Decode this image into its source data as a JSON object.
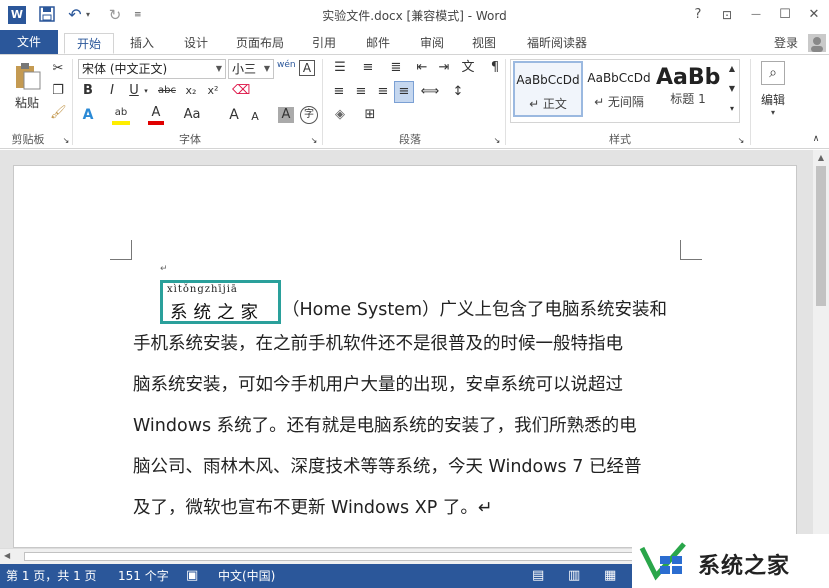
{
  "window": {
    "title": "实验文件.docx [兼容模式] - Word",
    "help": "?",
    "ribbon_display": "⊡",
    "minimize": "—",
    "maximize": "☐",
    "close": "✕"
  },
  "quick_access": {
    "word_icon": "W",
    "save": "💾",
    "undo": "↶",
    "redo": "↻",
    "customize": "≡"
  },
  "tabs": [
    {
      "label": "文件"
    },
    {
      "label": "开始"
    },
    {
      "label": "插入"
    },
    {
      "label": "设计"
    },
    {
      "label": "页面布局"
    },
    {
      "label": "引用"
    },
    {
      "label": "邮件"
    },
    {
      "label": "审阅"
    },
    {
      "label": "视图"
    },
    {
      "label": "福昕阅读器"
    }
  ],
  "signin": "登录",
  "ribbon": {
    "clipboard": {
      "paste": "粘贴",
      "label": "剪贴板"
    },
    "font": {
      "name": "宋体 (中文正文)",
      "size": "小三",
      "wen": "wén",
      "A_box": "A",
      "bold": "B",
      "italic": "I",
      "underline": "U",
      "strike": "abc",
      "sub": "x₂",
      "sup": "x²",
      "grow": "A",
      "shrink": "A",
      "case": "Aa",
      "label": "字体"
    },
    "paragraph": {
      "label": "段落"
    },
    "styles": {
      "items": [
        {
          "sample": "AaBbCcDd",
          "name": "↵ 正文"
        },
        {
          "sample": "AaBbCcDd",
          "name": "↵ 无间隔"
        },
        {
          "sample": "AaBb",
          "name": "标题 1"
        }
      ],
      "label": "样式"
    },
    "editing": {
      "label": "编辑"
    }
  },
  "document": {
    "ruby_pinyin": "xìtǒngzhījiā",
    "ruby_chars": "系统之家",
    "lines": [
      "（Home System）广义上包含了电脑系统安装和",
      "手机系统安装，在之前手机软件还不是很普及的时候一般特指电",
      "脑系统安装，可如今手机用户大量的出现，安卓系统可以说超过",
      "Windows 系统了。还有就是电脑系统的安装了，我们所熟悉的电",
      "脑公司、雨林木风、深度技术等等系统，今天 Windows 7 已经普",
      "及了，微软也宣布不更新 Windows XP 了。↵"
    ],
    "para_mark": "↵"
  },
  "status": {
    "page": "第 1 页，共 1 页",
    "words": "151 个字",
    "lang": "中文(中国)"
  },
  "watermark": {
    "text": "系统之家"
  },
  "colors": {
    "accent": "#2b579a",
    "ruby_border": "#2aa09b"
  }
}
